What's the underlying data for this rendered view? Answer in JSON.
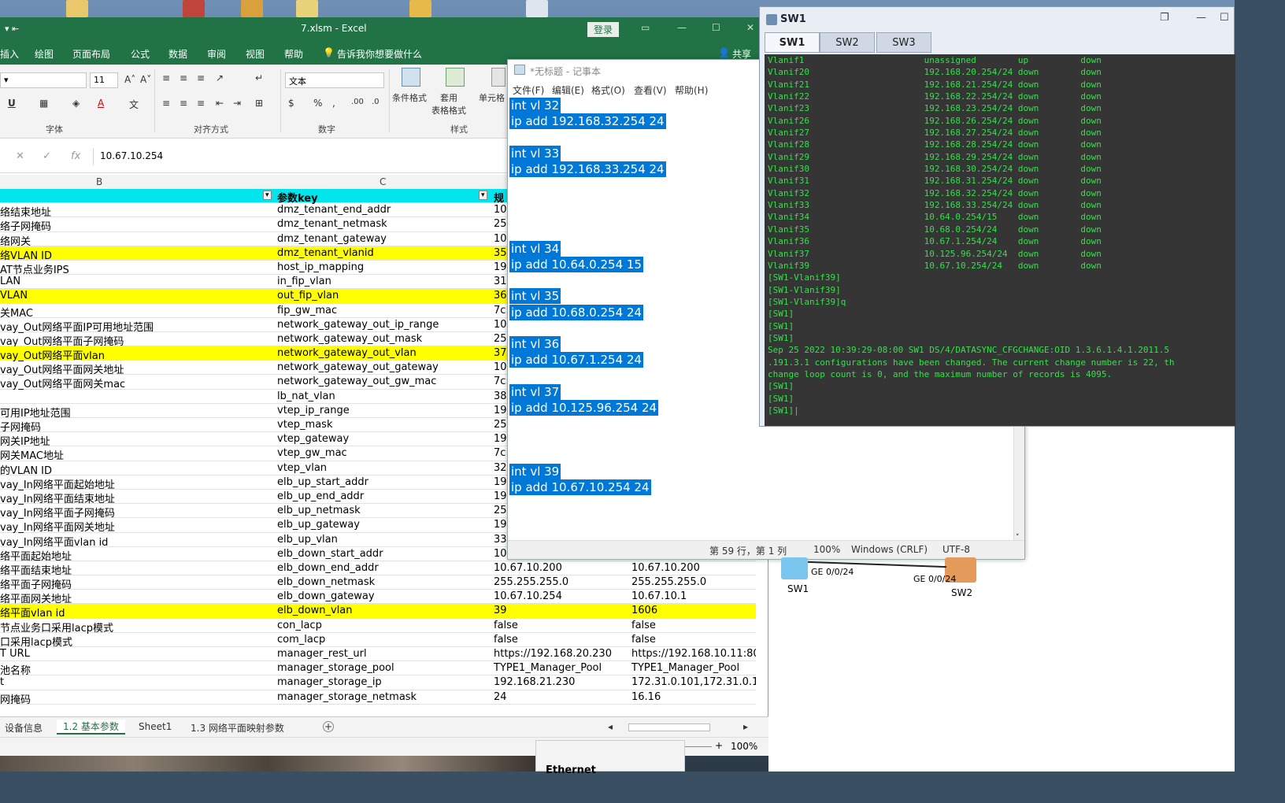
{
  "excel": {
    "quick_access": "▾ ⇤",
    "file_name": "7.xlsm  -  Excel",
    "login": "登录",
    "tabs": [
      "插入",
      "绘图",
      "页面布局",
      "公式",
      "数据",
      "审阅",
      "视图",
      "帮助",
      "告诉我你想要做什么"
    ],
    "share": "共享",
    "font_size": "11",
    "number_format": "文本",
    "groups": [
      "字体",
      "对齐方式",
      "数字",
      "样式"
    ],
    "style_buttons": [
      "条件格式",
      "套用\n表格格式",
      "单元格"
    ],
    "formula_value": "10.67.10.254",
    "col_headers": [
      "B",
      "C"
    ],
    "header_row": {
      "b": "",
      "c": "参数key",
      "d": "规"
    },
    "rows": [
      {
        "b": "络结束地址",
        "c": "dmz_tenant_end_addr",
        "d": "10.",
        "e": "",
        "hl": false
      },
      {
        "b": "络子网掩码",
        "c": "dmz_tenant_netmask",
        "d": "25",
        "e": "",
        "hl": false
      },
      {
        "b": "络网关",
        "c": "dmz_tenant_gateway",
        "d": "10.",
        "e": "",
        "hl": false
      },
      {
        "b": "络VLAN ID",
        "c": "dmz_tenant_vlanid",
        "d": "35",
        "e": "",
        "hl": true
      },
      {
        "b": "AT节点业务IPS",
        "c": "host_ip_mapping",
        "d": "19",
        "e": "",
        "hl": false
      },
      {
        "b": "LAN",
        "c": "in_fip_vlan",
        "d": "31",
        "e": "",
        "hl": false
      },
      {
        "b": "VLAN",
        "c": "out_fip_vlan",
        "d": "36",
        "e": "",
        "hl": true
      },
      {
        "b": "关MAC",
        "c": "fip_gw_mac",
        "d": "7c:",
        "e": "",
        "hl": false
      },
      {
        "b": "vay_Out网络平面IP可用地址范围",
        "c": "network_gateway_out_ip_range",
        "d": "10.",
        "e": "",
        "hl": false
      },
      {
        "b": "vay_Out网络平面子网掩码",
        "c": "network_gateway_out_mask",
        "d": "25",
        "e": "",
        "hl": false
      },
      {
        "b": "vay_Out网络平面vlan",
        "c": "network_gateway_out_vlan",
        "d": "37",
        "e": "",
        "hl": true
      },
      {
        "b": "vay_Out网络平面网关地址",
        "c": "network_gateway_out_gateway",
        "d": "10.",
        "e": "",
        "hl": false
      },
      {
        "b": "vay_Out网络平面网关mac",
        "c": "network_gateway_out_gw_mac",
        "d": "7c:",
        "e": "",
        "hl": false
      },
      {
        "b": "",
        "c": "lb_nat_vlan",
        "d": "38",
        "e": "",
        "hl": false
      },
      {
        "b": "可用IP地址范围",
        "c": "vtep_ip_range",
        "d": "19",
        "e": "",
        "hl": false
      },
      {
        "b": "子网掩码",
        "c": "vtep_mask",
        "d": "25",
        "e": "",
        "hl": false
      },
      {
        "b": "网关IP地址",
        "c": "vtep_gateway",
        "d": "19",
        "e": "",
        "hl": false
      },
      {
        "b": "网关MAC地址",
        "c": "vtep_gw_mac",
        "d": "7c:",
        "e": "",
        "hl": false
      },
      {
        "b": "的VLAN ID",
        "c": "vtep_vlan",
        "d": "32",
        "e": "",
        "hl": false
      },
      {
        "b": "vay_In网络平面起始地址",
        "c": "elb_up_start_addr",
        "d": "19",
        "e": "",
        "hl": false
      },
      {
        "b": "vay_In网络平面结束地址",
        "c": "elb_up_end_addr",
        "d": "19",
        "e": "",
        "hl": false
      },
      {
        "b": "vay_In网络平面子网掩码",
        "c": "elb_up_netmask",
        "d": "25",
        "e": "",
        "hl": false
      },
      {
        "b": "vay_In网络平面网关地址",
        "c": "elb_up_gateway",
        "d": "19",
        "e": "",
        "hl": false
      },
      {
        "b": "vay_In网络平面vlan id",
        "c": "elb_up_vlan",
        "d": "33",
        "e": "",
        "hl": false
      },
      {
        "b": "络平面起始地址",
        "c": "elb_down_start_addr",
        "d": "10.",
        "e": "",
        "hl": false
      },
      {
        "b": "络平面结束地址",
        "c": "elb_down_end_addr",
        "d": "10.67.10.200",
        "e": "10.67.10.200",
        "hl": false
      },
      {
        "b": "络平面子网掩码",
        "c": "elb_down_netmask",
        "d": "255.255.255.0",
        "e": "255.255.255.0",
        "hl": false
      },
      {
        "b": "络平面网关地址",
        "c": "elb_down_gateway",
        "d": "10.67.10.254",
        "e": "10.67.10.1",
        "hl": false
      },
      {
        "b": "络平面vlan id",
        "c": "elb_down_vlan",
        "d": "39",
        "e": "1606",
        "hl": true
      },
      {
        "b": "节点业务口采用lacp模式",
        "c": "con_lacp",
        "d": "false",
        "e": "false",
        "hl": false
      },
      {
        "b": "口采用lacp模式",
        "c": "com_lacp",
        "d": "false",
        "e": "false",
        "hl": false
      },
      {
        "b": "T URL",
        "c": "manager_rest_url",
        "d": "https://192.168.20.230",
        "e": "https://192.168.10.11:808",
        "hl": false
      },
      {
        "b": "池名称",
        "c": "manager_storage_pool",
        "d": "TYPE1_Manager_Pool",
        "e": "TYPE1_Manager_Pool",
        "hl": false
      },
      {
        "b": "t",
        "c": "manager_storage_ip",
        "d": "192.168.21.230",
        "e": "172.31.0.101,172.31.0.10",
        "hl": false
      },
      {
        "b": "网掩码",
        "c": "manager_storage_netmask",
        "d": "24",
        "e": "16.16",
        "hl": false
      }
    ],
    "sheets": [
      "设备信息",
      "1.2 基本参数",
      "Sheet1",
      "1.3 网络平面映射参数"
    ],
    "active_sheet": "1.2 基本参数",
    "zoom": "100%"
  },
  "notepad": {
    "title": "*无标题 - 记事本",
    "menu": [
      "文件(F)",
      "编辑(E)",
      "格式(O)",
      "查看(V)",
      "帮助(H)"
    ],
    "lines": [
      "int vl 32",
      "ip add 192.168.32.254 24",
      "",
      "int vl 33",
      "ip add 192.168.33.254 24",
      "",
      "",
      "",
      "",
      "int vl 34",
      "ip add 10.64.0.254 15",
      "",
      "int vl 35",
      "ip add 10.68.0.254 24",
      "",
      "int vl 36",
      "ip add 10.67.1.254 24",
      "",
      "int vl 37",
      "ip add 10.125.96.254 24",
      "",
      " ",
      "",
      "int vl 39",
      "ip add 10.67.10.254 24"
    ],
    "status": {
      "pos": "第 59 行，第 1 列",
      "zoom": "100%",
      "eol": "Windows (CRLF)",
      "enc": "UTF-8"
    }
  },
  "terminal": {
    "title": "SW1",
    "tabs": [
      "SW1",
      "SW2",
      "SW3"
    ],
    "lines": [
      "Vlanif1                       unassigned        up          down",
      "Vlanif20                      192.168.20.254/24 down        down",
      "Vlanif21                      192.168.21.254/24 down        down",
      "Vlanif22                      192.168.22.254/24 down        down",
      "Vlanif23                      192.168.23.254/24 down        down",
      "Vlanif26                      192.168.26.254/24 down        down",
      "Vlanif27                      192.168.27.254/24 down        down",
      "Vlanif28                      192.168.28.254/24 down        down",
      "Vlanif29                      192.168.29.254/24 down        down",
      "Vlanif30                      192.168.30.254/24 down        down",
      "Vlanif31                      192.168.31.254/24 down        down",
      "Vlanif32                      192.168.32.254/24 down        down",
      "Vlanif33                      192.168.33.254/24 down        down",
      "Vlanif34                      10.64.0.254/15    down        down",
      "Vlanif35                      10.68.0.254/24    down        down",
      "Vlanif36                      10.67.1.254/24    down        down",
      "Vlanif37                      10.125.96.254/24  down        down",
      "Vlanif39                      10.67.10.254/24   down        down",
      "[SW1-Vlanif39]",
      "[SW1-Vlanif39]",
      "[SW1-Vlanif39]q",
      "[SW1]",
      "[SW1]",
      "[SW1]",
      "Sep 25 2022 10:39:29-08:00 SW1 DS/4/DATASYNC_CFGCHANGE:OID 1.3.6.1.4.1.2011.5",
      ".191.3.1 configurations have been changed. The current change number is 22, th",
      "change loop count is 0, and the maximum number of records is 4095.",
      "[SW1]",
      "[SW1]",
      "[SW1]|"
    ]
  },
  "topology": {
    "sw1": "SW1",
    "sw2": "SW2",
    "port1": "GE 0/0/24",
    "port2": "GE 0/0/24"
  },
  "ethernet": "Ethernet"
}
